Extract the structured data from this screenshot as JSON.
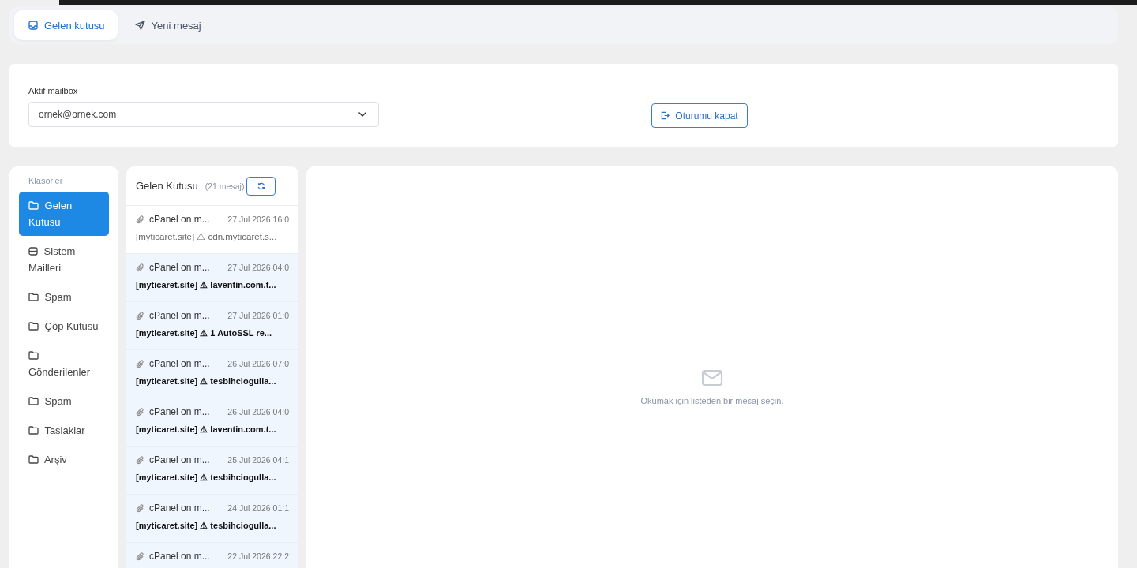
{
  "tabs": [
    {
      "label": "Gelen kutusu",
      "kind": "inbox",
      "selected": true
    },
    {
      "label": "Yeni mesaj",
      "kind": "send",
      "selected": false
    }
  ],
  "mailbox": {
    "label": "Aktif mailbox",
    "value": "ornek@ornek.com",
    "logout": "Oturumu kapat"
  },
  "folders": {
    "title": "Klasörler",
    "items": [
      {
        "label": "Gelen Kutusu",
        "kind": "folder",
        "selected": true
      },
      {
        "label": "Sistem Mailleri",
        "kind": "system",
        "selected": false
      },
      {
        "label": "Spam",
        "kind": "folder",
        "selected": false
      },
      {
        "label": "Çöp Kutusu",
        "kind": "folder",
        "selected": false
      },
      {
        "label": "Gönderilenler",
        "kind": "folder",
        "selected": false
      },
      {
        "label": "Spam",
        "kind": "folder",
        "selected": false
      },
      {
        "label": "Taslaklar",
        "kind": "folder",
        "selected": false
      },
      {
        "label": "Arşiv",
        "kind": "folder",
        "selected": false
      }
    ]
  },
  "message_list": {
    "title": "Gelen Kutusu",
    "count": "(21 mesaj)",
    "messages": [
      {
        "sender": "cPanel on m...",
        "date": "27 Jul 2026 16:0",
        "subject": "[myticaret.site] ⚠ cdn.myticaret.s...",
        "unread": false
      },
      {
        "sender": "cPanel on m...",
        "date": "27 Jul 2026 04:0",
        "subject": "[myticaret.site] ⚠ laventin.com.t...",
        "unread": true
      },
      {
        "sender": "cPanel on m...",
        "date": "27 Jul 2026 01:0",
        "subject": "[myticaret.site] ⚠ 1 AutoSSL re...",
        "unread": true
      },
      {
        "sender": "cPanel on m...",
        "date": "26 Jul 2026 07:0",
        "subject": "[myticaret.site] ⚠ tesbihciogulla...",
        "unread": true
      },
      {
        "sender": "cPanel on m...",
        "date": "26 Jul 2026 04:0",
        "subject": "[myticaret.site] ⚠ laventin.com.t...",
        "unread": true
      },
      {
        "sender": "cPanel on m...",
        "date": "25 Jul 2026 04:1",
        "subject": "[myticaret.site] ⚠ tesbihciogulla...",
        "unread": true
      },
      {
        "sender": "cPanel on m...",
        "date": "24 Jul 2026 01:1",
        "subject": "[myticaret.site] ⚠ tesbihciogulla...",
        "unread": true
      },
      {
        "sender": "cPanel on m...",
        "date": "22 Jul 2026 22:2",
        "unread": true
      }
    ]
  },
  "reader": {
    "empty_text": "Okumak için listeden bir mesaj seçin."
  }
}
